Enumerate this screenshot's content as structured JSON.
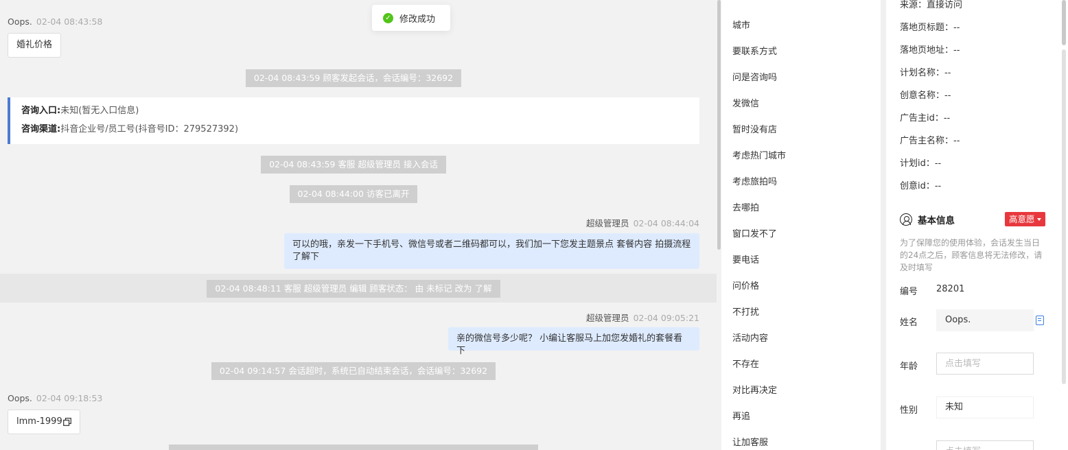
{
  "toast": {
    "text": "修改成功"
  },
  "chat": {
    "messages": [
      {
        "sender": "Oops.",
        "time": "02-04 08:43:58",
        "text": "婚礼价格"
      },
      {
        "sender": "超级管理员",
        "time": "02-04 08:44:04",
        "text": "可以的哦，亲发一下手机号、微信号或者二维码都可以，我们加一下您发主题景点 套餐内容 拍摄流程了解下"
      },
      {
        "sender": "超级管理员",
        "time": "02-04 09:05:21",
        "text": "亲的微信号多少呢？ 小编让客服马上加您发婚礼的套餐看下"
      },
      {
        "sender": "Oops.",
        "time": "02-04 09:18:53",
        "text": "lmm-1999"
      }
    ],
    "system": [
      "02-04 08:43:59 顾客发起会话，会话编号：32692",
      "02-04 08:43:59 客服 超级管理员 接入会话",
      "02-04 08:44:00 访客已离开",
      "02-04 08:48:11 客服 超级管理员 编辑 顾客状态： 由 未标记 改为 了解",
      "02-04 09:14:57 会话超时，系统已自动结束会话，会话编号：32692"
    ],
    "entry": {
      "entrance_label": "咨询入口:",
      "entrance_value": "未知(暂无入口信息)",
      "channel_label": "咨询渠道:",
      "channel_value": "抖音企业号/员工号(抖音号ID：279527392)"
    }
  },
  "phrases": [
    "城市",
    "要联系方式",
    "问是咨询吗",
    "发微信",
    "暂时没有店",
    "考虑热门城市",
    "考虑旅拍吗",
    "去哪拍",
    "窗口发不了",
    "要电话",
    "问价格",
    "不打扰",
    "活动内容",
    "不存在",
    "对比再决定",
    "再追",
    "让加客服"
  ],
  "info": {
    "source": "来源：直接访问",
    "lines": [
      "落地页标题：--",
      "落地页地址：--",
      "计划名称：--",
      "创意名称：--",
      "广告主id：--",
      "广告主名称：--",
      "计划id：--",
      "创意id：--"
    ],
    "section_title": "基本信息",
    "intent": "高意愿",
    "notice": "为了保障您的使用体验，会话发生当日的24点之后，顾客信息将无法修改，请及时填写",
    "id_label": "编号",
    "id_value": "28201",
    "name_label": "姓名",
    "name_value": "Oops.",
    "age_label": "年龄",
    "age_placeholder": "点击填写",
    "gender_label": "性别",
    "gender_value": "未知",
    "next_placeholder": "点击填写"
  }
}
